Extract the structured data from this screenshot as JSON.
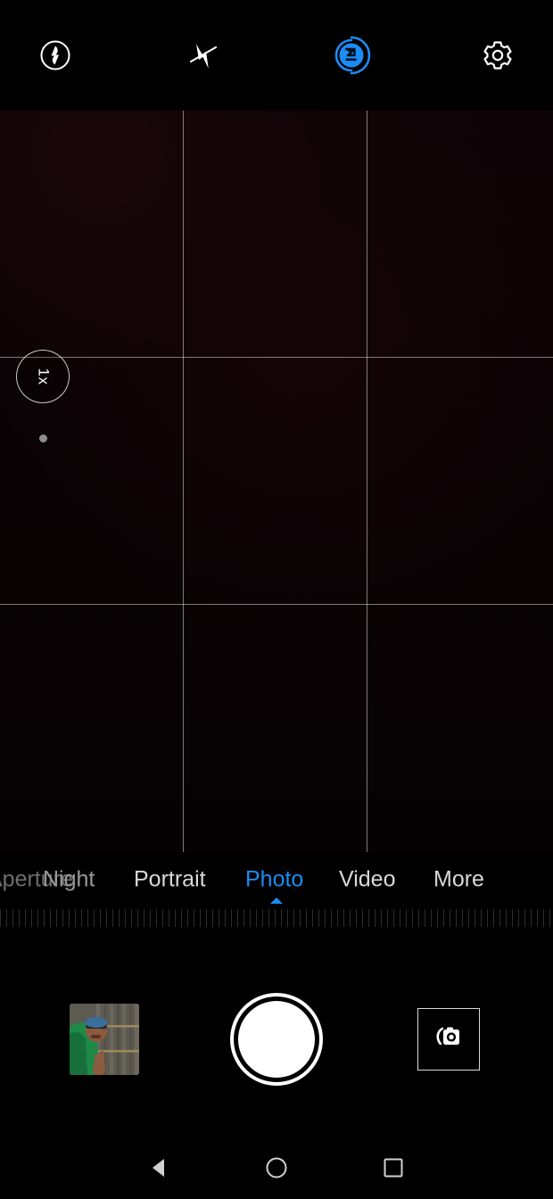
{
  "app": {
    "name": "Camera",
    "accent_color": "#1b8cf5",
    "background_color": "#000000"
  },
  "topbar": {
    "items": [
      {
        "id": "hdr",
        "icon": "hdr-auto-icon",
        "label": "HDR",
        "state": "off",
        "color": "#ffffff"
      },
      {
        "id": "flash",
        "icon": "flash-off-icon",
        "label": "Flash off",
        "state": "off",
        "color": "#ffffff"
      },
      {
        "id": "ai",
        "icon": "ai-camera-icon",
        "label": "AI Camera",
        "state": "on",
        "color": "#1b8cf5"
      },
      {
        "id": "settings",
        "icon": "gear-icon",
        "label": "Settings",
        "state": "idle",
        "color": "#ffffff"
      }
    ]
  },
  "viewfinder": {
    "grid_enabled": true,
    "grid_type": "rule-of-thirds",
    "grid_color": "#ebe8e6",
    "zoom": {
      "value_label": "1x",
      "slider_dot_visible": true
    }
  },
  "modes": {
    "items": [
      {
        "label": "Aperture",
        "active": false,
        "truncated": true
      },
      {
        "label": "Night",
        "active": false,
        "truncated": false
      },
      {
        "label": "Portrait",
        "active": false,
        "truncated": false
      },
      {
        "label": "Photo",
        "active": true,
        "truncated": false
      },
      {
        "label": "Video",
        "active": false,
        "truncated": false
      },
      {
        "label": "More",
        "active": false,
        "truncated": false
      }
    ],
    "selected": "Photo",
    "indicator_color": "#1b8cf5"
  },
  "bottombar": {
    "gallery_thumbnail": {
      "name": "last-photo-thumbnail",
      "description": "person in green shirt making peace sign in front of bamboo fence"
    },
    "shutter": {
      "label": "Shutter",
      "name": "shutter-button"
    },
    "camera_switch": {
      "label": "Switch camera",
      "name": "switch-camera-button"
    }
  },
  "navbar": {
    "items": [
      {
        "id": "back",
        "icon": "back-triangle-icon",
        "label": "Back"
      },
      {
        "id": "home",
        "icon": "home-circle-icon",
        "label": "Home"
      },
      {
        "id": "recent",
        "icon": "recents-square-icon",
        "label": "Recents"
      }
    ]
  }
}
